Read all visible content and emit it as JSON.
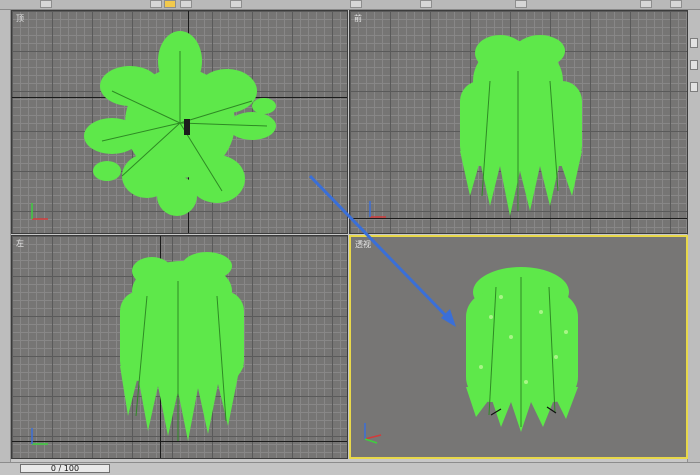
{
  "viewports": {
    "top": {
      "label": "顶"
    },
    "front": {
      "label": "前"
    },
    "left": {
      "label": "左"
    },
    "perspective": {
      "label": "透视"
    }
  },
  "timeline": {
    "frame_label": "0 / 100",
    "current_frame": 0,
    "total_frames": 100
  },
  "colors": {
    "foliage": "#5ee84a",
    "active_border": "#e8d84a",
    "arrow": "#3a6fd8"
  },
  "icons": [
    "select-icon",
    "axis-gizmo-icon",
    "pointer-arrow"
  ]
}
